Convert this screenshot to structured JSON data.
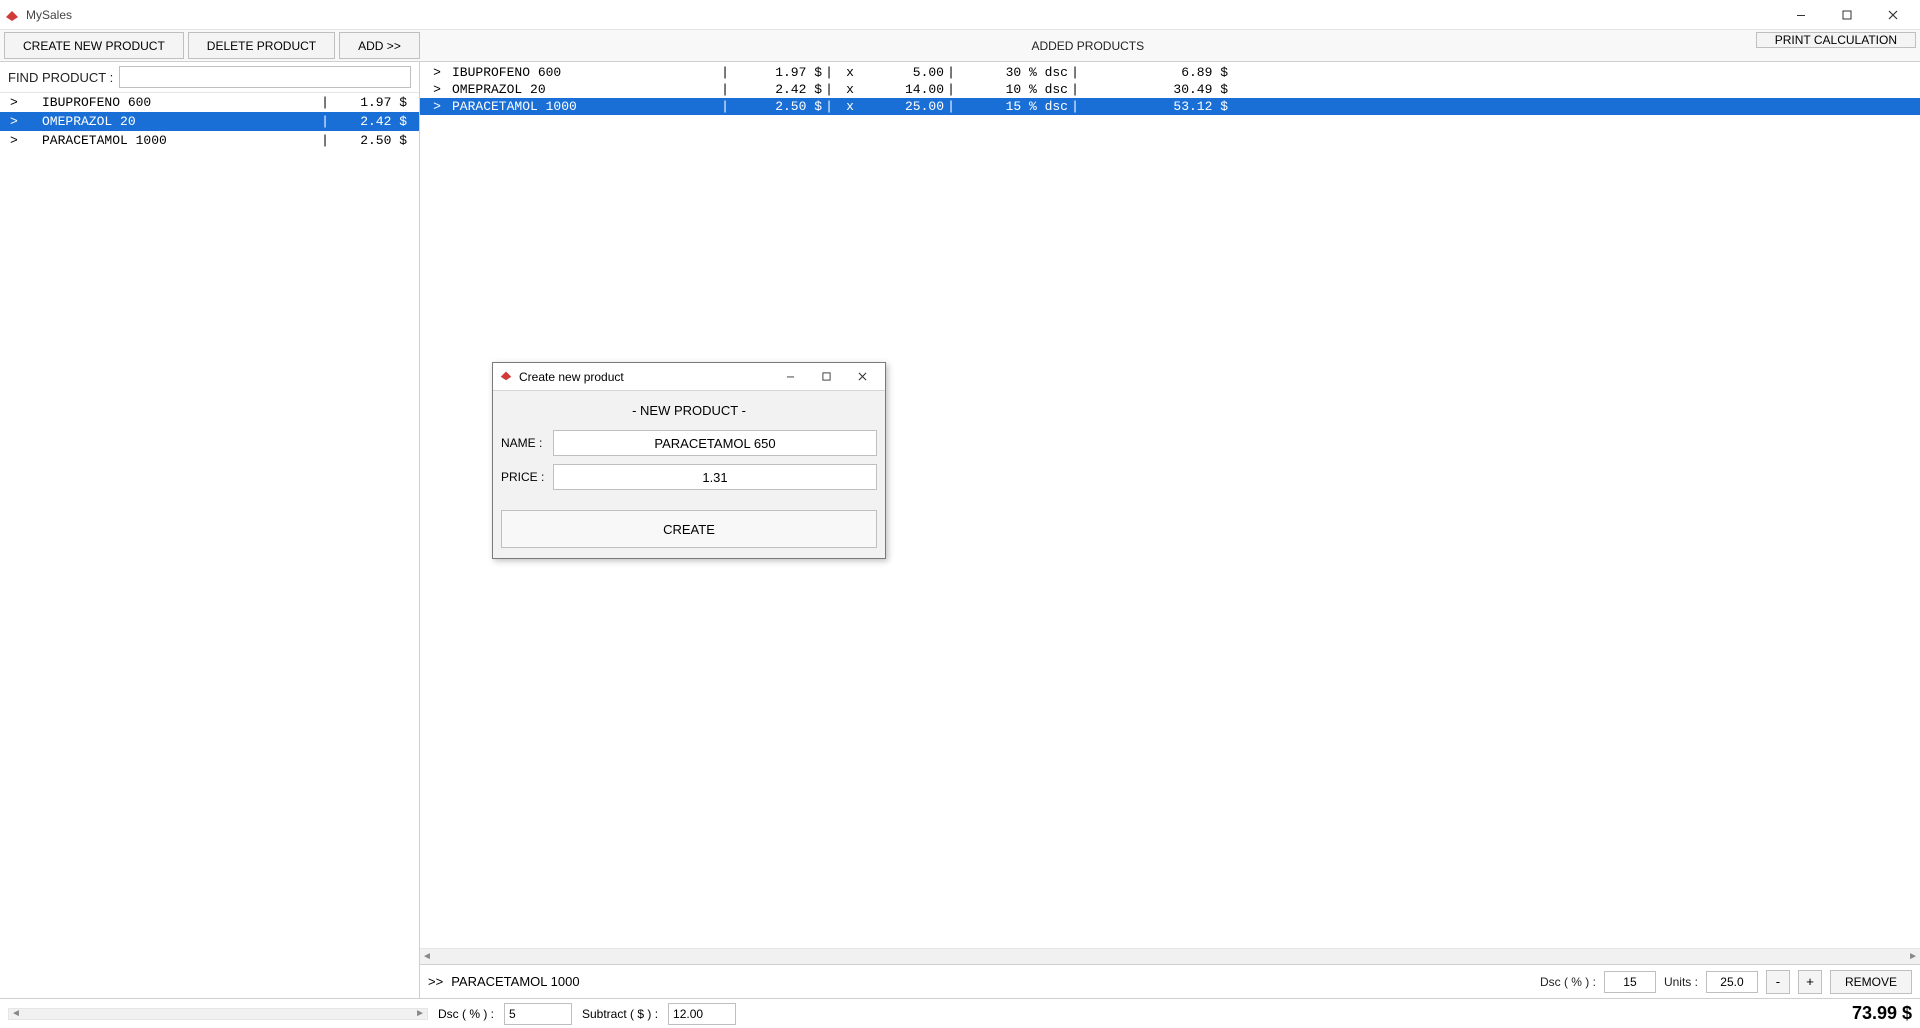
{
  "app": {
    "title": "MySales"
  },
  "toolbar": {
    "create_label": "CREATE NEW PRODUCT",
    "delete_label": "DELETE PRODUCT",
    "add_label": "ADD   >>",
    "added_label": "ADDED PRODUCTS",
    "print_label": "PRINT CALCULATION"
  },
  "find": {
    "label": "FIND PRODUCT :",
    "value": ""
  },
  "products": [
    {
      "name": "IBUPROFENO 600",
      "price": "1.97 $",
      "selected": false
    },
    {
      "name": "OMEPRAZOL 20",
      "price": "2.42 $",
      "selected": true
    },
    {
      "name": "PARACETAMOL 1000",
      "price": "2.50 $",
      "selected": false
    }
  ],
  "added": [
    {
      "name": "IBUPROFENO 600",
      "price": "1.97 $",
      "qty": "5.00",
      "dsc": "30 % dsc",
      "total": "6.89 $",
      "selected": false
    },
    {
      "name": "OMEPRAZOL 20",
      "price": "2.42 $",
      "qty": "14.00",
      "dsc": "10 % dsc",
      "total": "30.49 $",
      "selected": false
    },
    {
      "name": "PARACETAMOL 1000",
      "price": "2.50 $",
      "qty": "25.00",
      "dsc": "15 % dsc",
      "total": "53.12 $",
      "selected": true
    }
  ],
  "detail": {
    "marker": ">>",
    "name": "PARACETAMOL 1000",
    "dsc_label": "Dsc ( % ) :",
    "dsc_value": "15",
    "units_label": "Units :",
    "units_value": "25.0",
    "minus": "-",
    "plus": "+",
    "remove_label": "REMOVE"
  },
  "footer": {
    "dsc_label": "Dsc ( % ) :",
    "dsc_value": "5",
    "sub_label": "Subtract ( $ ) :",
    "sub_value": "12.00",
    "total": "73.99 $"
  },
  "dialog": {
    "title": "Create new product",
    "header": "- NEW PRODUCT -",
    "name_label": "NAME :",
    "name_value": "PARACETAMOL 650",
    "price_label": "PRICE :",
    "price_value": "1.31",
    "create_label": "CREATE"
  }
}
